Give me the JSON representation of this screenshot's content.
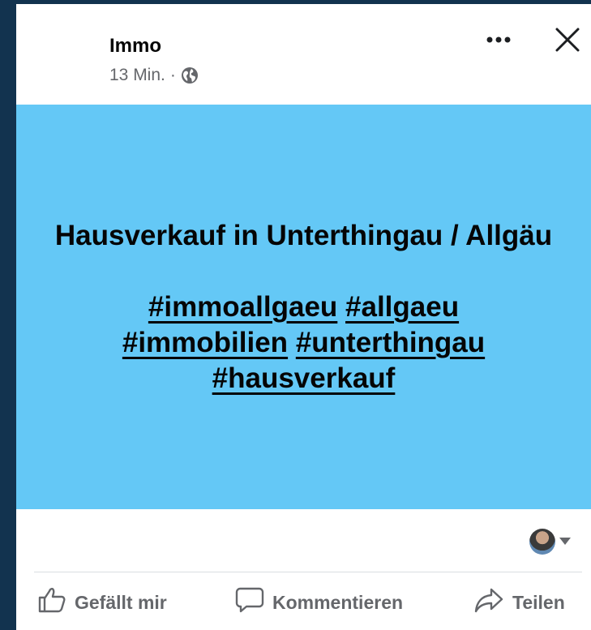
{
  "post": {
    "author": "Immo",
    "time": "13 Min.",
    "separator": "·",
    "visibility_icon": "globe-icon"
  },
  "banner": {
    "background": "#64c8f6",
    "headline": "Hausverkauf in Unterthingau / Allgäu",
    "hashtags": [
      {
        "text": "#immoallgaeu"
      },
      {
        "text": "#allgaeu"
      },
      {
        "text": "#immobilien"
      },
      {
        "text": "#unterthingau"
      },
      {
        "text": "#hausverkauf"
      }
    ]
  },
  "actions": {
    "like": "Gefällt mir",
    "comment": "Kommentieren",
    "share": "Teilen"
  },
  "icons": {
    "more": "more-options-icon",
    "close": "close-icon",
    "like": "thumbs-up-icon",
    "comment": "comment-icon",
    "share": "share-icon"
  }
}
